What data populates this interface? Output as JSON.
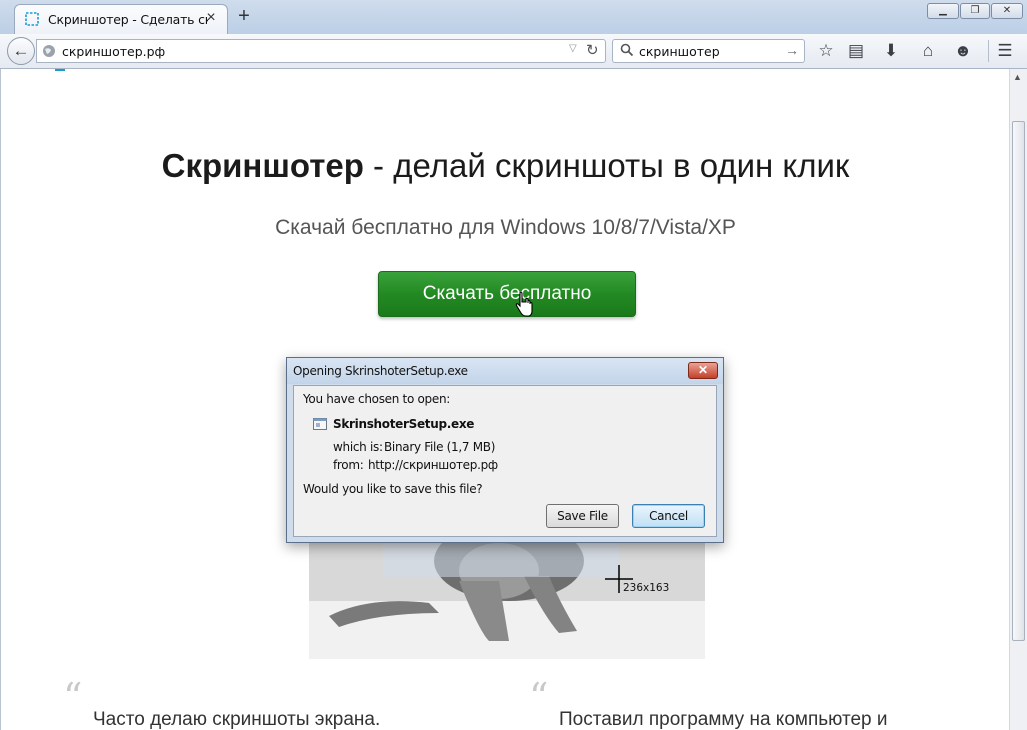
{
  "browser": {
    "tab_title": "Скриншотер - Сделать ск...",
    "tab_close": "×",
    "new_tab": "+",
    "url": "скриншотер.рф",
    "search_query": "скриншотер",
    "window_controls": {
      "minimize": "▁",
      "maximize": "❐",
      "close": "✕"
    },
    "toolbar_icons": [
      "star-icon",
      "reading-list-icon",
      "download-icon",
      "home-icon",
      "smiley-icon",
      "menu-icon"
    ]
  },
  "page": {
    "headline_bold": "Скриншотер",
    "headline_rest": " - делай скриншоты в один клик",
    "subline": "Скачай бесплатно для Windows 10/8/7/Vista/XP",
    "download_button": "Скачать бесплатно",
    "selection_size": "236x163",
    "quote_mark": "“",
    "quote_left": "Часто делаю скриншоты экрана.",
    "quote_right": "Поставил программу на компьютер и"
  },
  "dialog": {
    "title": "Opening SkrinshoterSetup.exe",
    "chosen_label": "You have chosen to open:",
    "filename": "SkrinshoterSetup.exe",
    "which_is_label": "which is:",
    "which_is_value": "Binary File (1,7 MB)",
    "from_label": "from:",
    "from_value": "http://скриншотер.рф",
    "question": "Would you like to save this file?",
    "save_button": "Save File",
    "cancel_button": "Cancel",
    "close_glyph": "✕"
  },
  "colors": {
    "download_green": "#238a23",
    "chrome_blue": "#cfdcec",
    "dialog_close_red": "#c4402a"
  }
}
